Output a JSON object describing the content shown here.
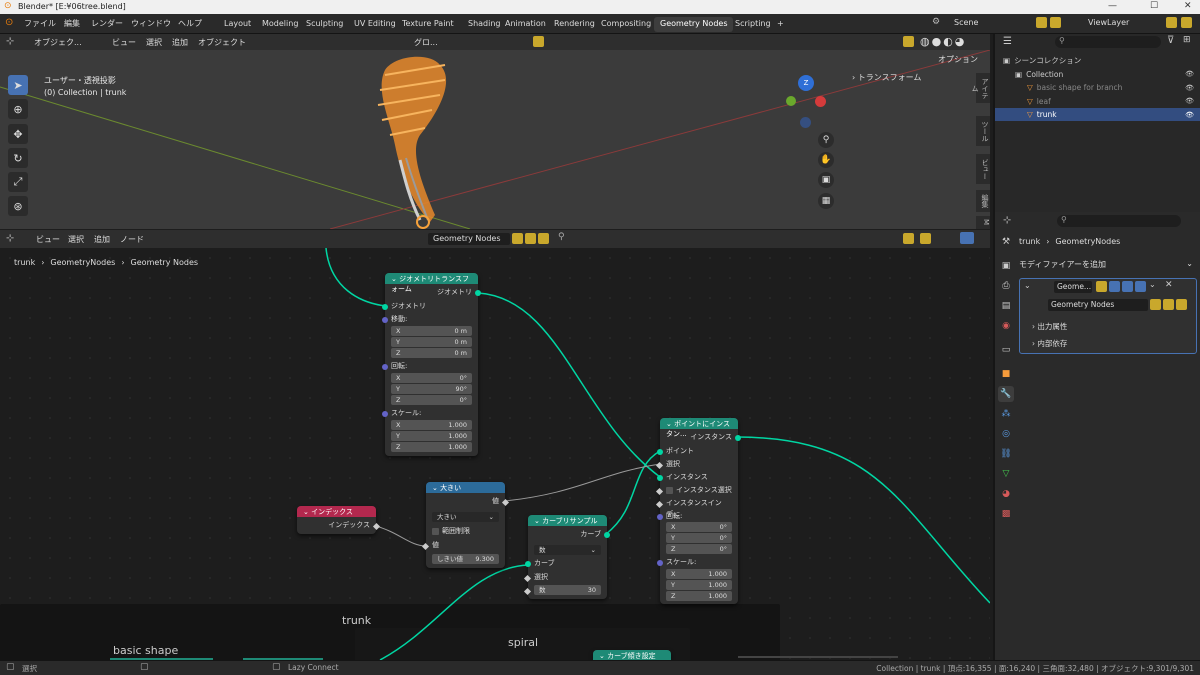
{
  "titlebar": {
    "title": "Blender* [E:¥06tree.blend]",
    "min": "—",
    "max": "☐",
    "close": "✕"
  },
  "menu": {
    "file": "ファイル",
    "edit": "編集",
    "render": "レンダー",
    "window": "ウィンドウ",
    "help": "ヘルプ"
  },
  "workspaces": [
    "Layout",
    "Modeling",
    "Sculpting",
    "UV Editing",
    "Texture Paint",
    "Shading",
    "Animation",
    "Rendering",
    "Compositing",
    "Geometry Nodes",
    "Scripting",
    "+"
  ],
  "active_workspace": "Geometry Nodes",
  "scene": {
    "label": "Scene",
    "viewlayer": "ViewLayer"
  },
  "viewport": {
    "mode": "オブジェク...",
    "view": "ビュー",
    "select": "選択",
    "add": "追加",
    "object": "オブジェクト",
    "orient": "グロ...",
    "options": "オプション",
    "info1": "ユーザー・透視投影",
    "info2": "(0) Collection | trunk",
    "transform_panel": "トランスフォーム",
    "tabs": [
      "アイテム",
      "ツール",
      "ビュー",
      "編集",
      "M"
    ],
    "axes": {
      "x": "X",
      "y": "Y",
      "z": "Z"
    }
  },
  "outliner": {
    "search": "",
    "rows": [
      {
        "label": "シーンコレクション",
        "indent": 0,
        "sel": false
      },
      {
        "label": "Collection",
        "indent": 1,
        "sel": false
      },
      {
        "label": "basic shape for branch",
        "indent": 2,
        "sel": false
      },
      {
        "label": "leaf",
        "indent": 2,
        "sel": false
      },
      {
        "label": "trunk",
        "indent": 2,
        "sel": true
      }
    ]
  },
  "nodeheader": {
    "view": "ビュー",
    "select": "選択",
    "add": "追加",
    "node": "ノード",
    "tree": "Geometry Nodes"
  },
  "breadcrumb": {
    "a": "trunk",
    "b": "GeometryNodes",
    "c": "Geometry Nodes"
  },
  "nodes": {
    "transform": {
      "title": "ジオメトリトランスフォーム",
      "out": "ジオメトリ",
      "in": "ジオメトリ",
      "translate": "移動:",
      "tx": "0 m",
      "ty": "0 m",
      "tz": "0 m",
      "rotate": "回転:",
      "rx": "0°",
      "ry": "90°",
      "rz": "0°",
      "scale": "スケール:",
      "sx": "1.000",
      "sy": "1.000",
      "sz": "1.000"
    },
    "compare": {
      "title": "大きい",
      "out": "値",
      "op": "大きい",
      "clamp": "範囲制限",
      "val": "値",
      "thresh": "しきい値",
      "thresh_val": "9.300"
    },
    "index": {
      "title": "インデックス",
      "out": "インデックス"
    },
    "resample": {
      "title": "カーブリサンプル",
      "out": "カーブ",
      "mode": "数",
      "curve": "カーブ",
      "select": "選択",
      "count": "数",
      "count_val": "30"
    },
    "inst": {
      "title": "ポイントにインスタン...",
      "out": "インスタンス",
      "points": "ポイント",
      "select": "選択",
      "instance": "インスタンス",
      "pick": "インスタンス選択",
      "index": "インスタンスインデ...",
      "rotate": "回転:",
      "rx": "0°",
      "ry": "0°",
      "rz": "0°",
      "scale": "スケール:",
      "sx": "1.000",
      "sy": "1.000",
      "sz": "1.000"
    },
    "curvefill": {
      "title": "カーブ傾き設定"
    }
  },
  "frames": {
    "trunk": "trunk",
    "spiral": "spiral",
    "basic": "basic shape"
  },
  "axis_labels": {
    "x": "X",
    "y": "Y",
    "z": "Z"
  },
  "props": {
    "crumb_a": "trunk",
    "crumb_b": "GeometryNodes",
    "add_mod": "モディファイアーを追加",
    "mod_name": "Geome...",
    "tree": "Geometry Nodes",
    "out_attr": "出力属性",
    "internal": "内部依存"
  },
  "status": {
    "select": "選択",
    "lazy": "Lazy Connect",
    "info": "Collection | trunk | 頂点:16,355 | 面:16,240 | 三角面:32,480 | オブジェクト:9,301/9,301"
  },
  "colors": {
    "accent": "#4772b3",
    "geo_node": "#1e8a76",
    "wire": "#00d6a3",
    "selection": "#f7a23b"
  }
}
